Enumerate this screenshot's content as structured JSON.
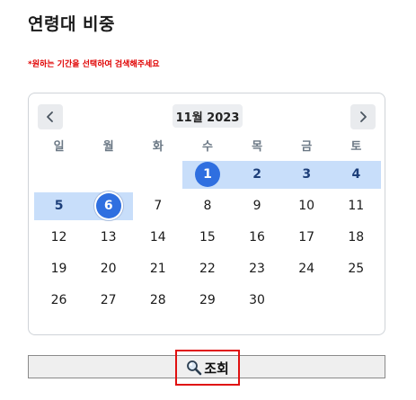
{
  "page": {
    "title": "연령대 비중",
    "notice": "*원하는 기간을 선택하여 검색해주세요"
  },
  "calendar": {
    "month_label": "11월 2023",
    "weekdays": [
      "일",
      "월",
      "화",
      "수",
      "목",
      "금",
      "토"
    ],
    "weeks": [
      [
        "",
        "",
        "",
        "1",
        "2",
        "3",
        "4"
      ],
      [
        "5",
        "6",
        "7",
        "8",
        "9",
        "10",
        "11"
      ],
      [
        "12",
        "13",
        "14",
        "15",
        "16",
        "17",
        "18"
      ],
      [
        "19",
        "20",
        "21",
        "22",
        "23",
        "24",
        "25"
      ],
      [
        "26",
        "27",
        "28",
        "29",
        "30",
        "",
        ""
      ]
    ],
    "range_start": "1",
    "range_end": "6",
    "accent_color": "#2f6fe0",
    "range_color": "#c8defa",
    "prev_icon": "chevron-left-icon",
    "next_icon": "chevron-right-icon"
  },
  "search": {
    "button_label": "조회",
    "icon": "magnifier-icon"
  }
}
